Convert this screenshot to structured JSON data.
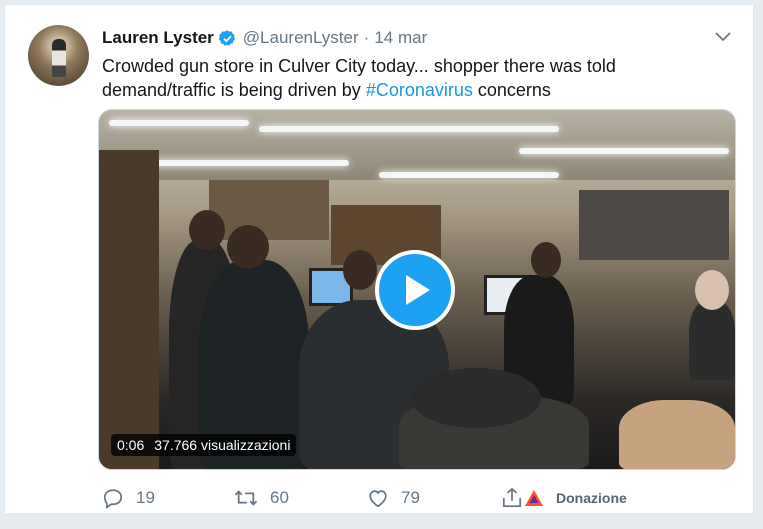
{
  "tweet": {
    "author_name": "Lauren Lyster",
    "handle": "@LaurenLyster",
    "separator": "·",
    "date": "14 mar",
    "text_before": "Crowded gun store in Culver City today... shopper there was told demand/traffic is being driven by ",
    "hashtag": "#Coronavirus",
    "text_after": " concerns"
  },
  "media": {
    "duration": "0:06",
    "views": "37.766 visualizzazioni"
  },
  "actions": {
    "replies": "19",
    "retweets": "60",
    "likes": "79",
    "donation_label": "Donazione"
  },
  "colors": {
    "accent": "#1da1f2",
    "hashtag": "#1b95e0",
    "secondary_text": "#657786",
    "background": "#e6ecf0"
  },
  "icons": [
    "verified-badge-icon",
    "chevron-down-icon",
    "play-icon",
    "reply-icon",
    "retweet-icon",
    "like-icon",
    "share-icon",
    "brave-rewards-icon"
  ]
}
